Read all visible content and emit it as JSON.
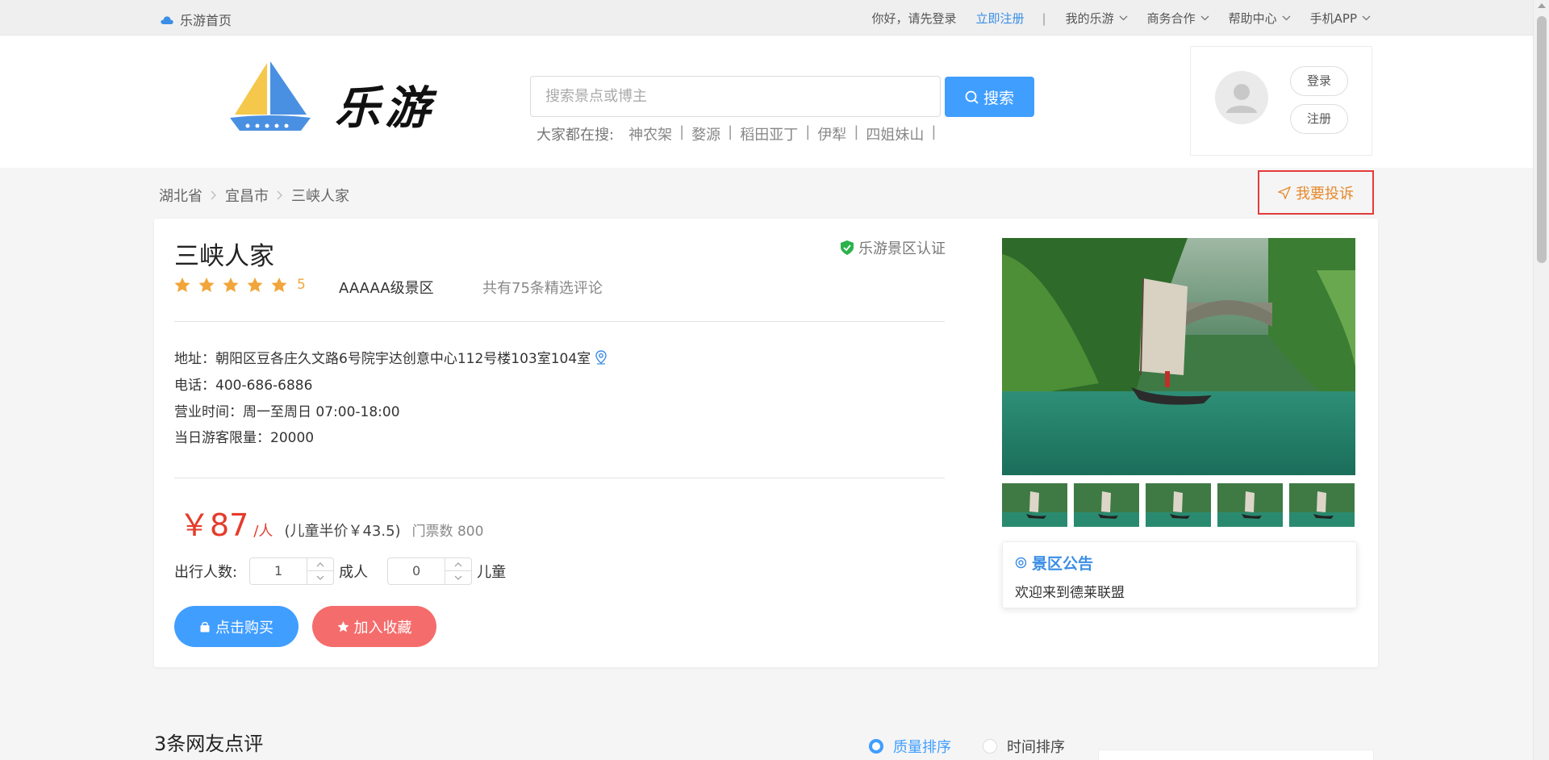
{
  "topbar": {
    "home_label": "乐游首页",
    "greeting": "你好，请先登录",
    "register": "立即注册",
    "separator": "|",
    "menu": [
      "我的乐游",
      "商务合作",
      "帮助中心",
      "手机APP"
    ]
  },
  "header": {
    "logo_text": "乐游",
    "search_placeholder": "搜索景点或博主",
    "search_button": "搜索",
    "hot_label": "大家都在搜:",
    "hot_items": [
      "神农架",
      "婺源",
      "稻田亚丁",
      "伊犁",
      "四姐妹山"
    ],
    "login": "登录",
    "register": "注册"
  },
  "breadcrumb": [
    "湖北省",
    "宜昌市",
    "三峡人家"
  ],
  "complain_label": "我要投诉",
  "scenic": {
    "name": "三峡人家",
    "cert": "乐游景区认证",
    "rating_stars": 5,
    "score": "5",
    "level": "AAAAA级景区",
    "review_summary": "共有75条精选评论",
    "address": "地址：朝阳区豆各庄久文路6号院宇达创意中心112号楼103室104室",
    "phone": "电话：400-686-6886",
    "hours": "营业时间：周一至周日 07:00-18:00",
    "limit": "当日游客限量：20000",
    "price": "￥87",
    "price_unit": "/人",
    "child_price": "(儿童半价￥43.5)",
    "stock": "门票数 800",
    "travelers_label": "出行人数:",
    "adults": "1",
    "adult_unit": "成人",
    "children": "0",
    "child_unit": "儿童",
    "buy_button": "点击购买",
    "fav_button": "加入收藏"
  },
  "notice": {
    "title": "景区公告",
    "body": "欢迎来到德莱联盟"
  },
  "reviews": {
    "title": "3条网友点评",
    "sort_options": [
      "质量排序",
      "时间排序"
    ],
    "selected_sort": "质量排序"
  },
  "colors": {
    "accent": "#409eff",
    "price": "#e43b2b",
    "favorite": "#f56c6c",
    "star": "#f2a53a",
    "complain_border": "#e43b3b",
    "complain_text": "#e6892b"
  }
}
